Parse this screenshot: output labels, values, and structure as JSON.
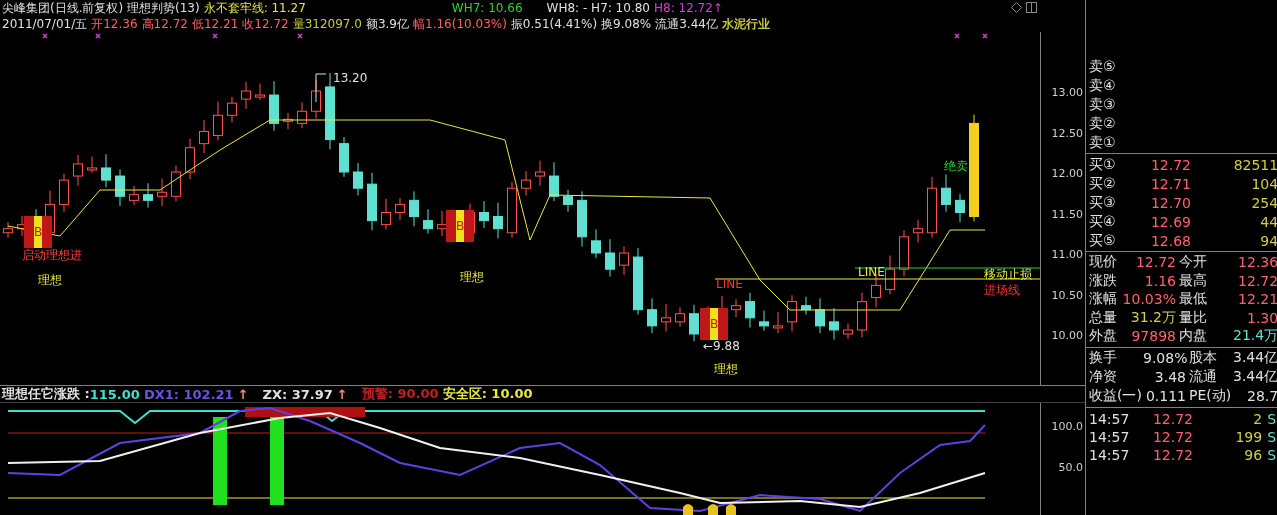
{
  "header": {
    "line1": [
      {
        "text": "尖峰集团(日线.前复权) 理想判势(13)",
        "color": "#e0e0e0"
      },
      {
        "text": "永不套牢线: 11.27",
        "color": "#e8e840"
      },
      {
        "text": "WH7: 10.66",
        "color": "#30d030"
      },
      {
        "text": "WH8: -  H7: 10.80",
        "color": "#e0e0e0"
      },
      {
        "text": "H8: 12.72↑",
        "color": "#d040d0"
      }
    ],
    "line2": [
      {
        "text": "2011/07/01/五",
        "color": "#e0e0e0"
      },
      {
        "text": "开12.36",
        "color": "#ff6060"
      },
      {
        "text": "高12.72",
        "color": "#ff6060"
      },
      {
        "text": "低12.21",
        "color": "#ff6060"
      },
      {
        "text": "收12.72",
        "color": "#ff6060"
      },
      {
        "text": "量312097.0",
        "color": "#c8c840"
      },
      {
        "text": "额3.9亿",
        "color": "#e0e0e0"
      },
      {
        "text": "幅1.16(10.03%)",
        "color": "#ff6060"
      },
      {
        "text": "振0.51(4.41%)",
        "color": "#e0e0e0"
      },
      {
        "text": "换9.08%",
        "color": "#e0e0e0"
      },
      {
        "text": "流通3.44亿",
        "color": "#e0e0e0"
      },
      {
        "text": "水泥行业",
        "color": "#c8c840"
      }
    ]
  },
  "main_chart": {
    "y_labels": [
      "13.00",
      "12.50",
      "12.00",
      "11.50",
      "11.00",
      "10.50",
      "10.00"
    ],
    "buy_markers": [
      "B",
      "B",
      "B"
    ],
    "annotations": [
      "13.20",
      "绝卖",
      "启动理想进",
      "理想",
      "理想",
      "LINE",
      "移动止损",
      "LINE",
      "进场线",
      "←9.88",
      "理想"
    ]
  },
  "indicator": {
    "title": [
      {
        "text": "理想任它涨跌 : ",
        "color": "#e0e0e0"
      },
      {
        "text": "115.00",
        "color": "#40e0d0"
      },
      {
        "text": "DX1: 102.21",
        "color": "#7050e0"
      },
      {
        "text": "↑",
        "color": "#ff8080"
      },
      {
        "text": "ZX: 37.97",
        "color": "#e0e0e0"
      },
      {
        "text": "↑",
        "color": "#ff8080"
      },
      {
        "text": "预警: 90.00",
        "color": "#c02020"
      },
      {
        "text": "安全区: 10.00",
        "color": "#e8e840"
      }
    ],
    "y_labels": [
      "100.0",
      "50.0"
    ]
  },
  "quote": {
    "sell": [
      "卖⑤",
      "卖④",
      "卖③",
      "卖②",
      "卖①"
    ],
    "buy": [
      {
        "label": "买①",
        "price": "12.72",
        "volume": "82511"
      },
      {
        "label": "买②",
        "price": "12.71",
        "volume": "104"
      },
      {
        "label": "买③",
        "price": "12.70",
        "volume": "254"
      },
      {
        "label": "买④",
        "price": "12.69",
        "volume": "44"
      },
      {
        "label": "买⑤",
        "price": "12.68",
        "volume": "94"
      }
    ],
    "stats": [
      [
        {
          "label": "现价",
          "value": "12.72",
          "color": "#ff6070"
        },
        {
          "label": "今开",
          "value": "12.36",
          "color": "#ff6070"
        }
      ],
      [
        {
          "label": "涨跌",
          "value": "1.16",
          "color": "#ff6070"
        },
        {
          "label": "最高",
          "value": "12.72",
          "color": "#ff6070"
        }
      ],
      [
        {
          "label": "涨幅",
          "value": "10.03%",
          "color": "#ff6070"
        },
        {
          "label": "最低",
          "value": "12.21",
          "color": "#ff6070"
        }
      ],
      [
        {
          "label": "总量",
          "value": "31.2万",
          "color": "#d0d040"
        },
        {
          "label": "量比",
          "value": "1.30",
          "color": "#ff6070"
        }
      ],
      [
        {
          "label": "外盘",
          "value": "97898",
          "color": "#ff6070"
        },
        {
          "label": "内盘",
          "value": "21.4万",
          "color": "#60e0d0"
        }
      ]
    ],
    "finance": [
      [
        {
          "label": "换手",
          "value": "9.08%"
        },
        {
          "label": "股本",
          "value": "3.44亿"
        }
      ],
      [
        {
          "label": "净资",
          "value": "3.48"
        },
        {
          "label": "流通",
          "value": "3.44亿"
        }
      ],
      [
        {
          "label": "收益(一)",
          "value": "0.111"
        },
        {
          "label": "PE(动)",
          "value": "28.7"
        }
      ]
    ],
    "trades": [
      {
        "time": "14:57",
        "price": "12.72",
        "volume": "2",
        "side": "S"
      },
      {
        "time": "14:57",
        "price": "12.72",
        "volume": "199",
        "side": "S"
      },
      {
        "time": "14:57",
        "price": "12.72",
        "volume": "96",
        "side": "S"
      }
    ]
  }
}
